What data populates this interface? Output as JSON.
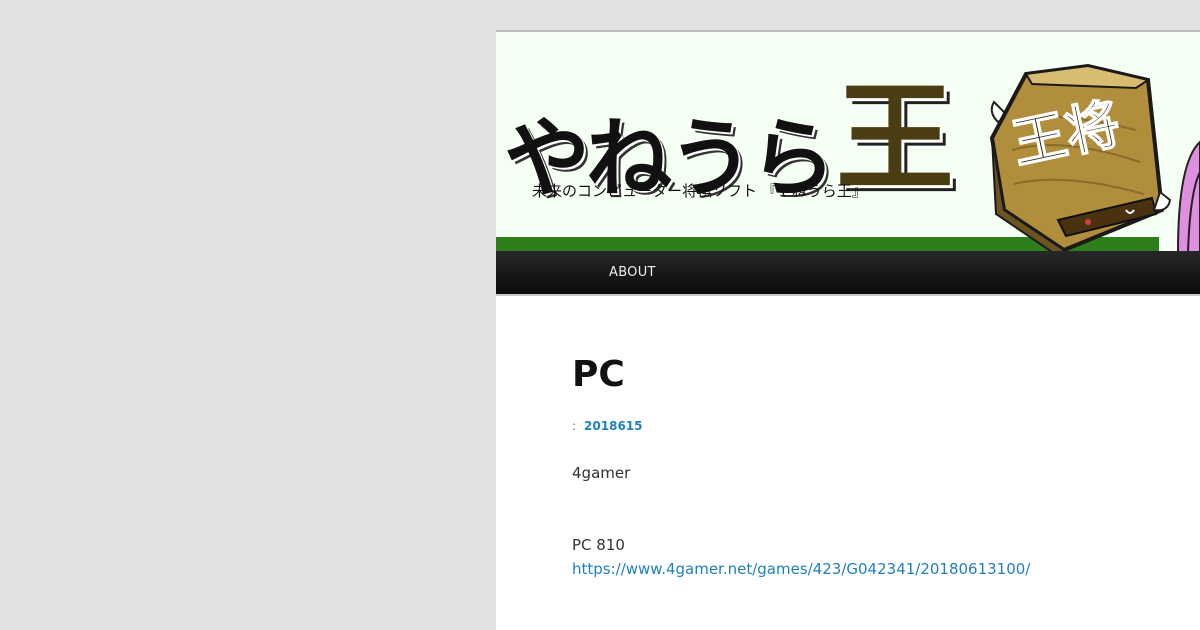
{
  "header": {
    "logo_kana": "やねうら",
    "logo_king": "王",
    "tagline": "未来のコンピューター将棋ソフト 『やねうら王』",
    "mascot_piece_text": "王将"
  },
  "nav": {
    "items": [
      {
        "label": "ABOUT"
      }
    ]
  },
  "post": {
    "title": "PC",
    "meta_prefix": ":",
    "date": "2018615",
    "paragraphs": [
      "4gamer",
      "PC 810"
    ],
    "link_text": "https://www.4gamer.net/games/423/G042341/20180613100/"
  },
  "colors": {
    "page_background": "#e2e2e2",
    "header_background": "#f6fff4",
    "green_bar": "#2f7e1c",
    "logo_king": "#4a3c13",
    "nav_background": "#111111",
    "link": "#1f80c2"
  }
}
